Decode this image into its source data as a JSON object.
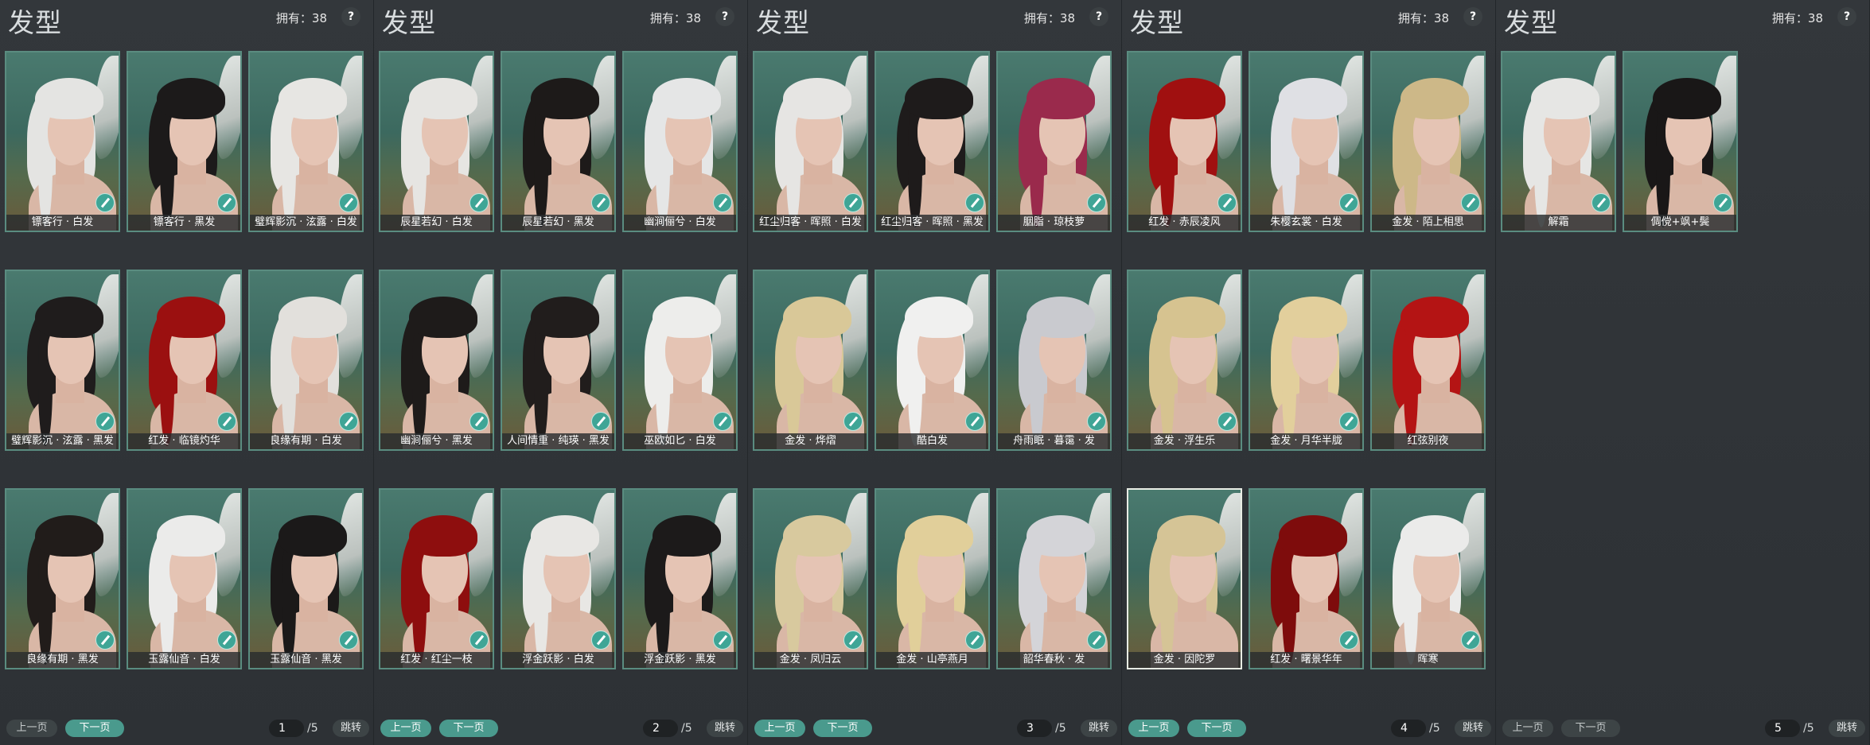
{
  "panel_title": "发型",
  "owned_text": "拥有：38",
  "help_label": "?",
  "prev_label": "上一页",
  "next_label": "下一页",
  "jump_label": "跳转",
  "total_pages": "/5",
  "colors": {
    "accent": "#4a9a8d",
    "card_border": "#5a8c80",
    "card_bg": "#3f6d63",
    "check": "#3fa596"
  },
  "pages": [
    {
      "page": "1",
      "items": [
        {
          "name": "镖客行 · 白发",
          "hair": "#e4e4e2",
          "owned": true
        },
        {
          "name": "镖客行 · 黑发",
          "hair": "#1c1a1a",
          "owned": true
        },
        {
          "name": "璧辉影沉 · 泫露 · 白发",
          "hair": "#e7e6e3",
          "owned": true
        },
        {
          "name": "璧辉影沉 · 泫露 · 黑发",
          "hair": "#1f1c1c",
          "owned": true
        },
        {
          "name": "红发 · 临镜灼华",
          "hair": "#9b1010",
          "owned": true
        },
        {
          "name": "良缘有期 · 白发",
          "hair": "#e2e0dc",
          "owned": true
        },
        {
          "name": "良缘有期 · 黑发",
          "hair": "#211c1a",
          "owned": true
        },
        {
          "name": "玉露仙音 · 白发",
          "hair": "#ebebea",
          "owned": true
        },
        {
          "name": "玉露仙音 · 黑发",
          "hair": "#1b1919",
          "owned": true
        }
      ]
    },
    {
      "page": "2",
      "items": [
        {
          "name": "辰星若幻 · 白发",
          "hair": "#e6e5e2",
          "owned": true
        },
        {
          "name": "辰星若幻 · 黑发",
          "hair": "#1d1a19",
          "owned": true
        },
        {
          "name": "幽涧俪兮 · 白发",
          "hair": "#e5e6e6",
          "owned": true
        },
        {
          "name": "幽涧俪兮 · 黑发",
          "hair": "#1e1b1a",
          "owned": true
        },
        {
          "name": "人间情重 · 纯瑛 · 黑发",
          "hair": "#211d1c",
          "owned": true
        },
        {
          "name": "巫欧如匕 · 白发",
          "hair": "#ededeb",
          "owned": true
        },
        {
          "name": "红发 · 红尘一枝",
          "hair": "#8e0e0e",
          "owned": true
        },
        {
          "name": "浮金跃影 · 白发",
          "hair": "#e8e7e4",
          "owned": true
        },
        {
          "name": "浮金跃影 · 黑发",
          "hair": "#1c1a1a",
          "owned": true
        }
      ]
    },
    {
      "page": "3",
      "items": [
        {
          "name": "红尘归客 · 晖照 · 白发",
          "hair": "#e6e5e3",
          "owned": true
        },
        {
          "name": "红尘归客 · 晖照 · 黑发",
          "hair": "#1e1b1b",
          "owned": true
        },
        {
          "name": "胭脂 · 琼枝萝",
          "hair": "#9a2a4c",
          "owned": true
        },
        {
          "name": "金发 · 烨熠",
          "hair": "#d9c898",
          "owned": true
        },
        {
          "name": "酷白发",
          "hair": "#f0f0ef",
          "owned": true
        },
        {
          "name": "舟雨眠 · 暮霭 · 发",
          "hair": "#c9cacf",
          "owned": true
        },
        {
          "name": "金发 · 凤归云",
          "hair": "#d8c99e",
          "owned": true
        },
        {
          "name": "金发 · 山亭燕月",
          "hair": "#e1cf9a",
          "owned": true
        },
        {
          "name": "韶华春秋 · 发",
          "hair": "#d4d4d8",
          "owned": true
        }
      ]
    },
    {
      "page": "4",
      "items": [
        {
          "name": "红发 · 赤辰凌风",
          "hair": "#a01010",
          "owned": true
        },
        {
          "name": "朱樱玄裳 · 白发",
          "hair": "#dfe0e4",
          "owned": true
        },
        {
          "name": "金发 · 陌上相思",
          "hair": "#cdb888",
          "owned": true
        },
        {
          "name": "金发 · 浮生乐",
          "hair": "#d6c390",
          "owned": true
        },
        {
          "name": "金发 · 月华半胧",
          "hair": "#e2cf9c",
          "owned": true
        },
        {
          "name": "红弦别夜",
          "hair": "#b41414",
          "owned": false
        },
        {
          "name": "金发 · 因陀罗",
          "hair": "#d5c496",
          "owned": false,
          "selected": true
        },
        {
          "name": "红发 · 曙景华年",
          "hair": "#7e0c0c",
          "owned": true
        },
        {
          "name": "晖寒",
          "hair": "#ebebea",
          "owned": true
        }
      ]
    },
    {
      "page": "5",
      "items": [
        {
          "name": "解霜",
          "hair": "#e6e6e4",
          "owned": true
        },
        {
          "name": "倜傥+飒+鬓",
          "hair": "#191717",
          "owned": true
        }
      ]
    }
  ]
}
